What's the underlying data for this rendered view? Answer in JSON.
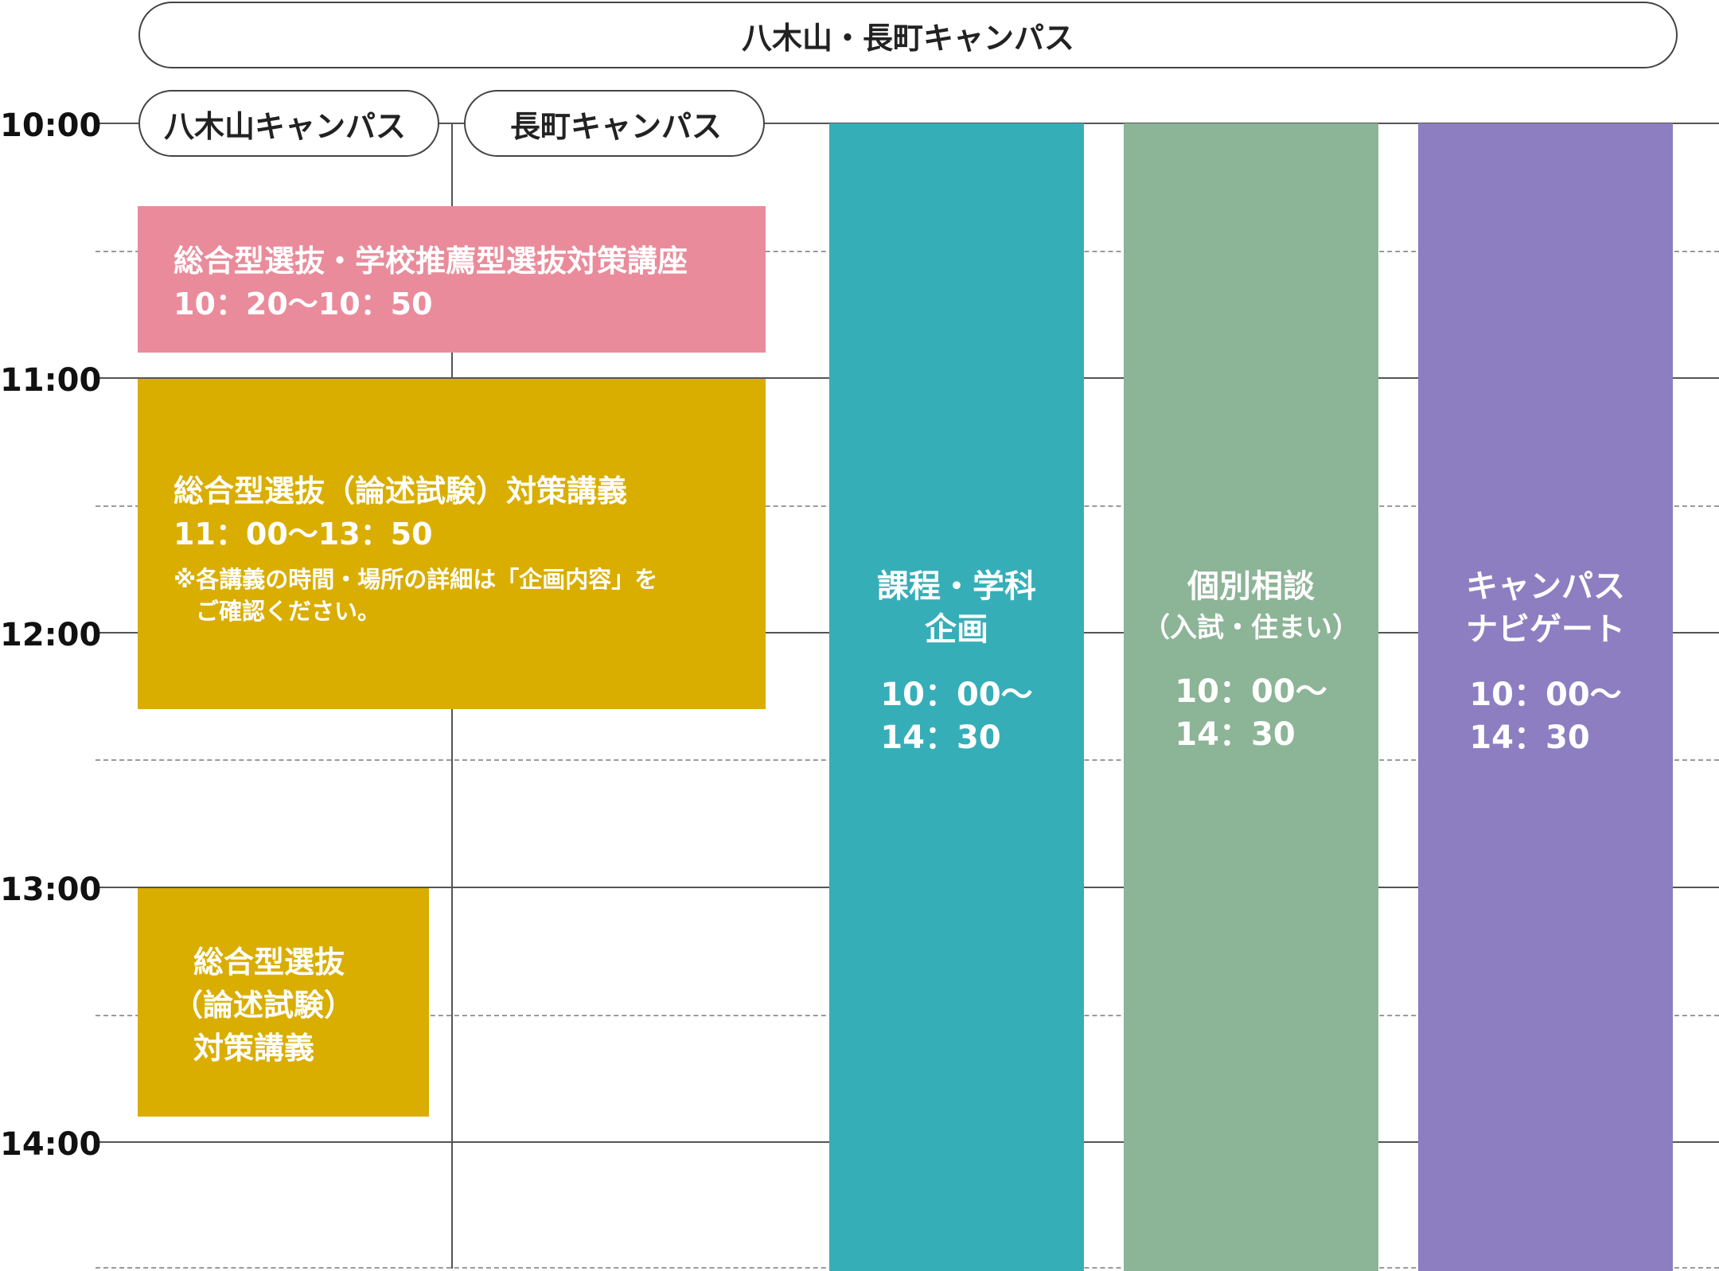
{
  "header": {
    "title": "八木山・長町キャンパス",
    "sub_campus_1": "八木山キャンパス",
    "sub_campus_2": "長町キャンパス"
  },
  "times": [
    "10:00",
    "11:00",
    "12:00",
    "13:00",
    "14:00"
  ],
  "events": {
    "pink": {
      "title": "総合型選抜・学校推薦型選抜対策講座",
      "time": "10：20〜10：50"
    },
    "gold1": {
      "title": "総合型選抜（論述試験）対策講義",
      "time": "11：00〜13：50",
      "note1": "※各講義の時間・場所の詳細は「企画内容」を",
      "note2": "ご確認ください。"
    },
    "gold2": {
      "line1": "総合型選抜",
      "line2": "（論述試験）",
      "line3": "対策講義"
    },
    "teal": {
      "title1": "課程・学科",
      "title2": "企画",
      "time1": "10：00〜",
      "time2": "14：30"
    },
    "green": {
      "title1": "個別相談",
      "sub": "（入試・住まい）",
      "time1": "10：00〜",
      "time2": "14：30"
    },
    "purple": {
      "title1": "キャンパス",
      "title2": "ナビゲート",
      "time1": "10：00〜",
      "time2": "14：30"
    }
  },
  "colors": {
    "pink": "#e98b9b",
    "gold": "#d9ae00",
    "teal": "#36aeb8",
    "green": "#8cb496",
    "purple": "#8d7ec1"
  }
}
